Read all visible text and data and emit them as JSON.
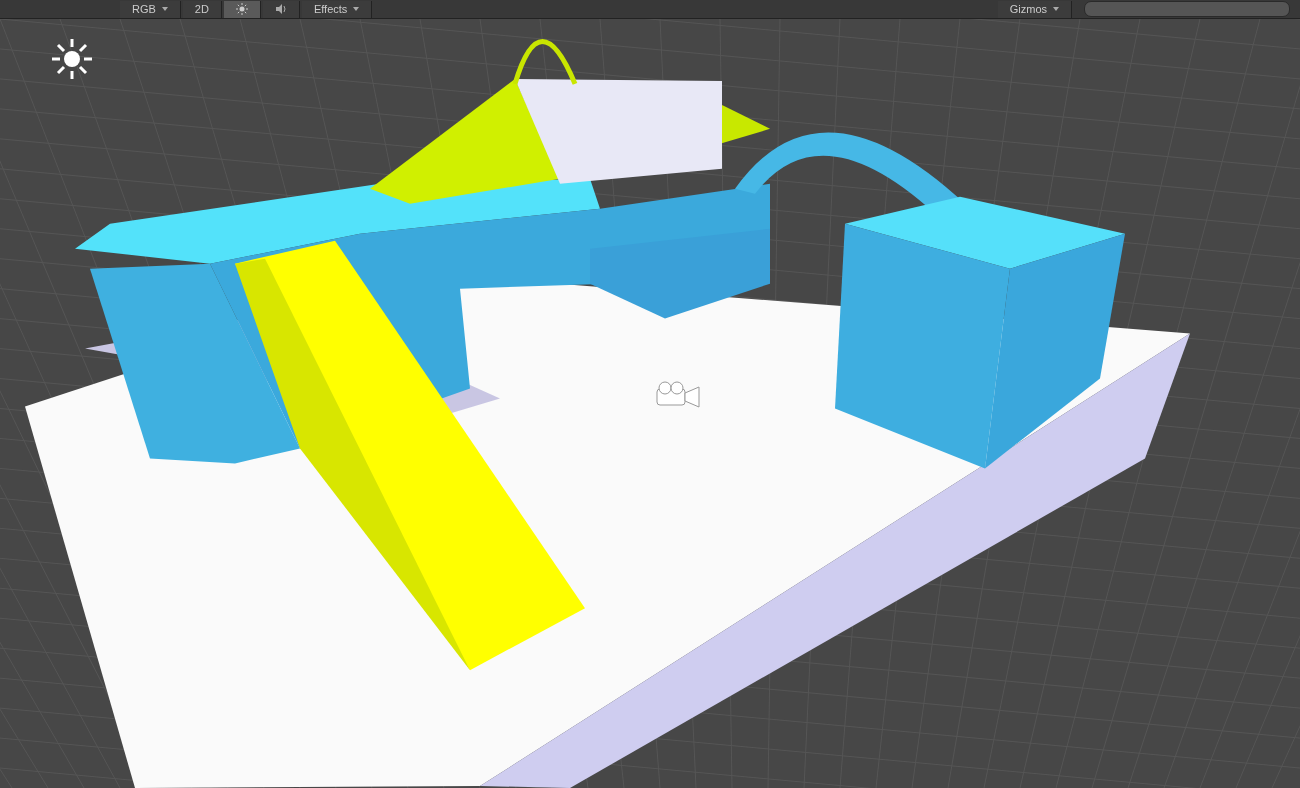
{
  "toolbar": {
    "left": [
      {
        "kind": "dropdown",
        "label": "RGB"
      },
      {
        "kind": "toggle",
        "label": "2D",
        "selected": false
      },
      {
        "kind": "light",
        "selected": true
      },
      {
        "kind": "audio",
        "selected": false
      },
      {
        "kind": "dropdown",
        "label": "Effects"
      }
    ],
    "right": [
      {
        "kind": "dropdown",
        "label": "Gizmos"
      },
      {
        "kind": "search"
      }
    ]
  }
}
